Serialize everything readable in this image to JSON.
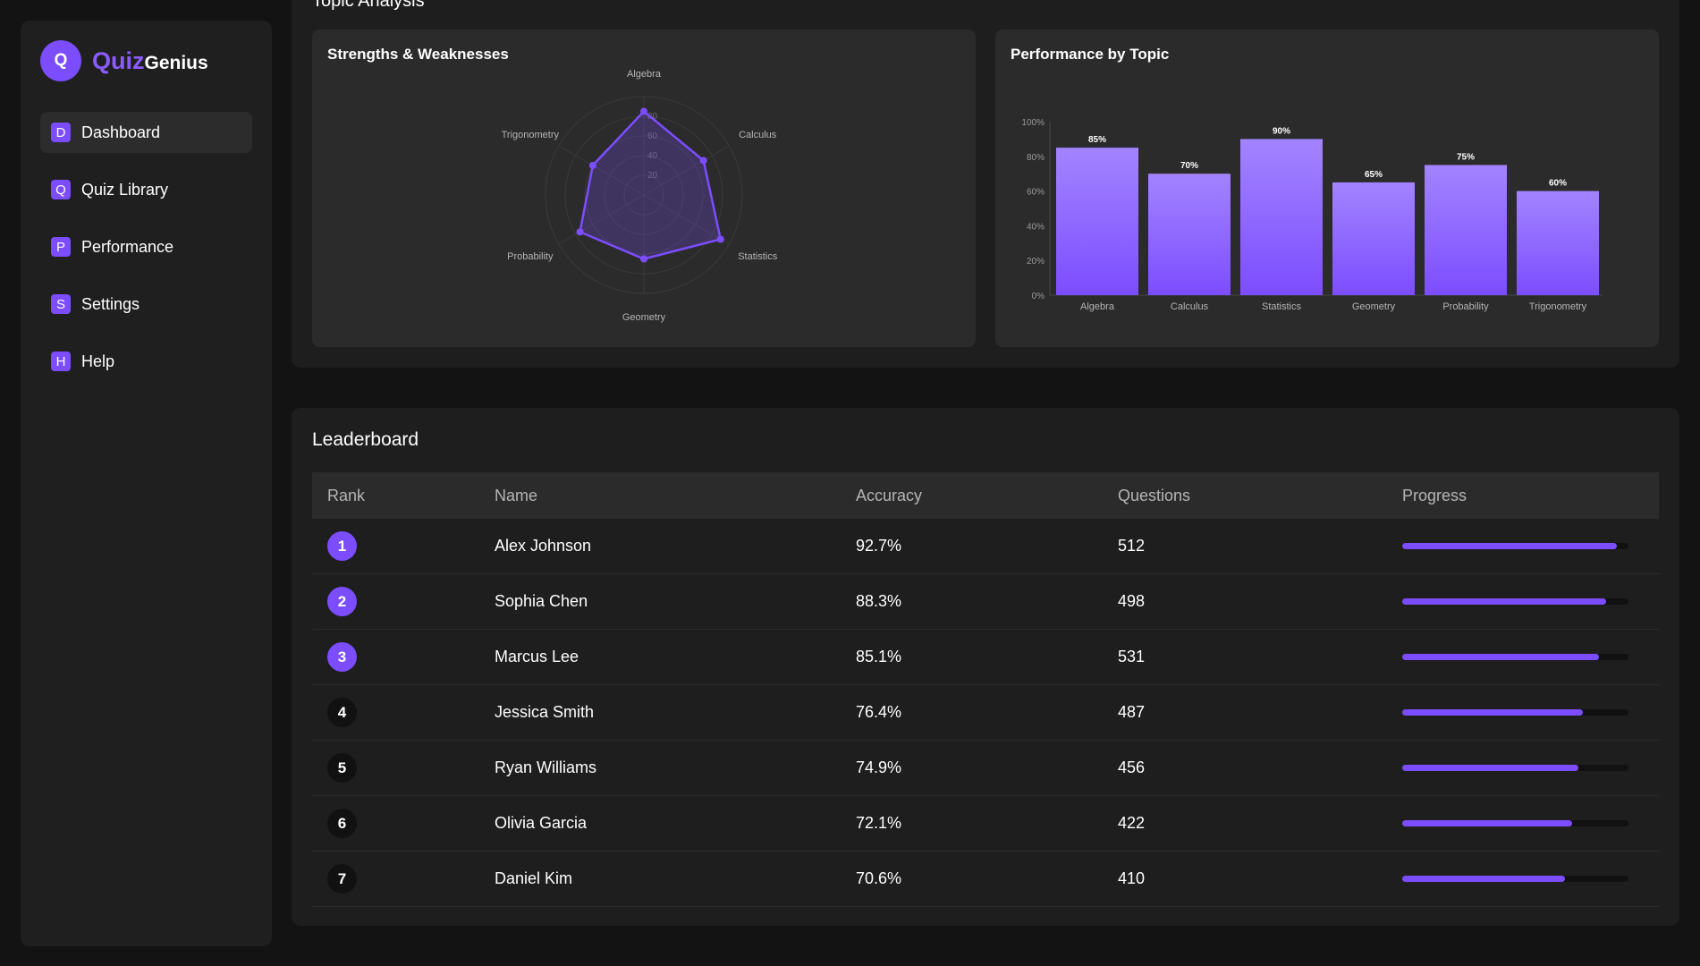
{
  "brand": {
    "logo_letter": "Q",
    "name_part1": "Quiz",
    "name_part2": "Genius"
  },
  "nav": [
    {
      "badge": "D",
      "label": "Dashboard",
      "active": true
    },
    {
      "badge": "Q",
      "label": "Quiz Library",
      "active": false
    },
    {
      "badge": "P",
      "label": "Performance",
      "active": false
    },
    {
      "badge": "S",
      "label": "Settings",
      "active": false
    },
    {
      "badge": "H",
      "label": "Help",
      "active": false
    }
  ],
  "topic_analysis": {
    "title": "Topic Analysis",
    "radar_title": "Strengths & Weaknesses",
    "bar_title": "Performance by Topic"
  },
  "chart_data": [
    {
      "type": "radar",
      "title": "Strengths & Weaknesses",
      "categories": [
        "Algebra",
        "Calculus",
        "Statistics",
        "Geometry",
        "Probability",
        "Trigonometry"
      ],
      "values": [
        85,
        70,
        90,
        65,
        75,
        60
      ],
      "radial_ticks": [
        "20",
        "40",
        "60",
        "80"
      ],
      "range": [
        0,
        100
      ]
    },
    {
      "type": "bar",
      "title": "Performance by Topic",
      "categories": [
        "Algebra",
        "Calculus",
        "Statistics",
        "Geometry",
        "Probability",
        "Trigonometry"
      ],
      "values": [
        85,
        70,
        90,
        65,
        75,
        60
      ],
      "data_labels": [
        "85%",
        "70%",
        "90%",
        "65%",
        "75%",
        "60%"
      ],
      "y_ticks": [
        "0%",
        "20%",
        "40%",
        "60%",
        "80%",
        "100%"
      ],
      "ylim": [
        0,
        100
      ]
    }
  ],
  "leaderboard": {
    "title": "Leaderboard",
    "columns": [
      "Rank",
      "Name",
      "Accuracy",
      "Questions",
      "Progress"
    ],
    "rows": [
      {
        "rank": "1",
        "name": "Alex Johnson",
        "accuracy": "92.7%",
        "questions": "512",
        "progress": 0.95,
        "top": true
      },
      {
        "rank": "2",
        "name": "Sophia Chen",
        "accuracy": "88.3%",
        "questions": "498",
        "progress": 0.9,
        "top": true
      },
      {
        "rank": "3",
        "name": "Marcus Lee",
        "accuracy": "85.1%",
        "questions": "531",
        "progress": 0.87,
        "top": true
      },
      {
        "rank": "4",
        "name": "Jessica Smith",
        "accuracy": "76.4%",
        "questions": "487",
        "progress": 0.8,
        "top": false
      },
      {
        "rank": "5",
        "name": "Ryan Williams",
        "accuracy": "74.9%",
        "questions": "456",
        "progress": 0.78,
        "top": false
      },
      {
        "rank": "6",
        "name": "Olivia Garcia",
        "accuracy": "72.1%",
        "questions": "422",
        "progress": 0.75,
        "top": false
      },
      {
        "rank": "7",
        "name": "Daniel Kim",
        "accuracy": "70.6%",
        "questions": "410",
        "progress": 0.72,
        "top": false
      }
    ]
  },
  "colors": {
    "accent": "#7c4dff",
    "accent_light": "#a07cff",
    "background": "#131313",
    "card": "#1e1e1e",
    "panel": "#2b2b2b"
  }
}
